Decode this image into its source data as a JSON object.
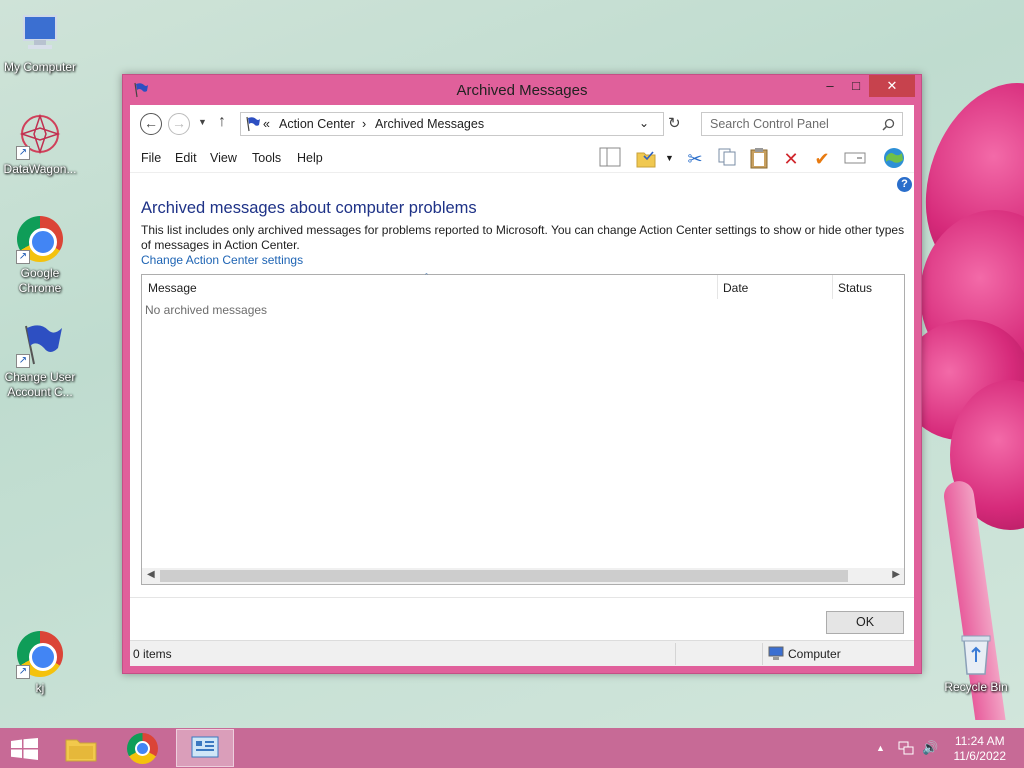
{
  "desktop": {
    "icons": [
      {
        "label": "My Computer"
      },
      {
        "label": "DataWagon..."
      },
      {
        "label": "Google Chrome"
      },
      {
        "label": "Change User Account C..."
      },
      {
        "label": "kj"
      },
      {
        "label": "Recycle Bin"
      }
    ]
  },
  "window": {
    "title": "Archived Messages",
    "controls": {
      "minimize": "–",
      "maximize": "□",
      "close": "✕"
    },
    "address": {
      "chevrons": "«",
      "crumbs": [
        "Action Center",
        "Archived Messages"
      ],
      "separator": "›"
    },
    "search": {
      "placeholder": "Search Control Panel"
    },
    "menu": [
      "File",
      "Edit",
      "View",
      "Tools",
      "Help"
    ],
    "heading": "Archived messages about computer problems",
    "description": "This list includes only archived messages for problems reported to Microsoft. You can change Action Center settings to show or hide other types of messages in Action Center.",
    "link": "Change Action Center settings",
    "list": {
      "columns": [
        "Message",
        "Date",
        "Status"
      ],
      "empty_text": "No archived messages"
    },
    "ok_label": "OK",
    "status": {
      "items": "0 items",
      "location": "Computer"
    }
  },
  "taskbar": {
    "time": "11:24 AM",
    "date": "11/6/2022"
  },
  "colors": {
    "window_frame": "#e0609b",
    "close_button": "#c7424d",
    "heading": "#1e3287",
    "link": "#1e64b4",
    "taskbar": "#c76a96"
  }
}
